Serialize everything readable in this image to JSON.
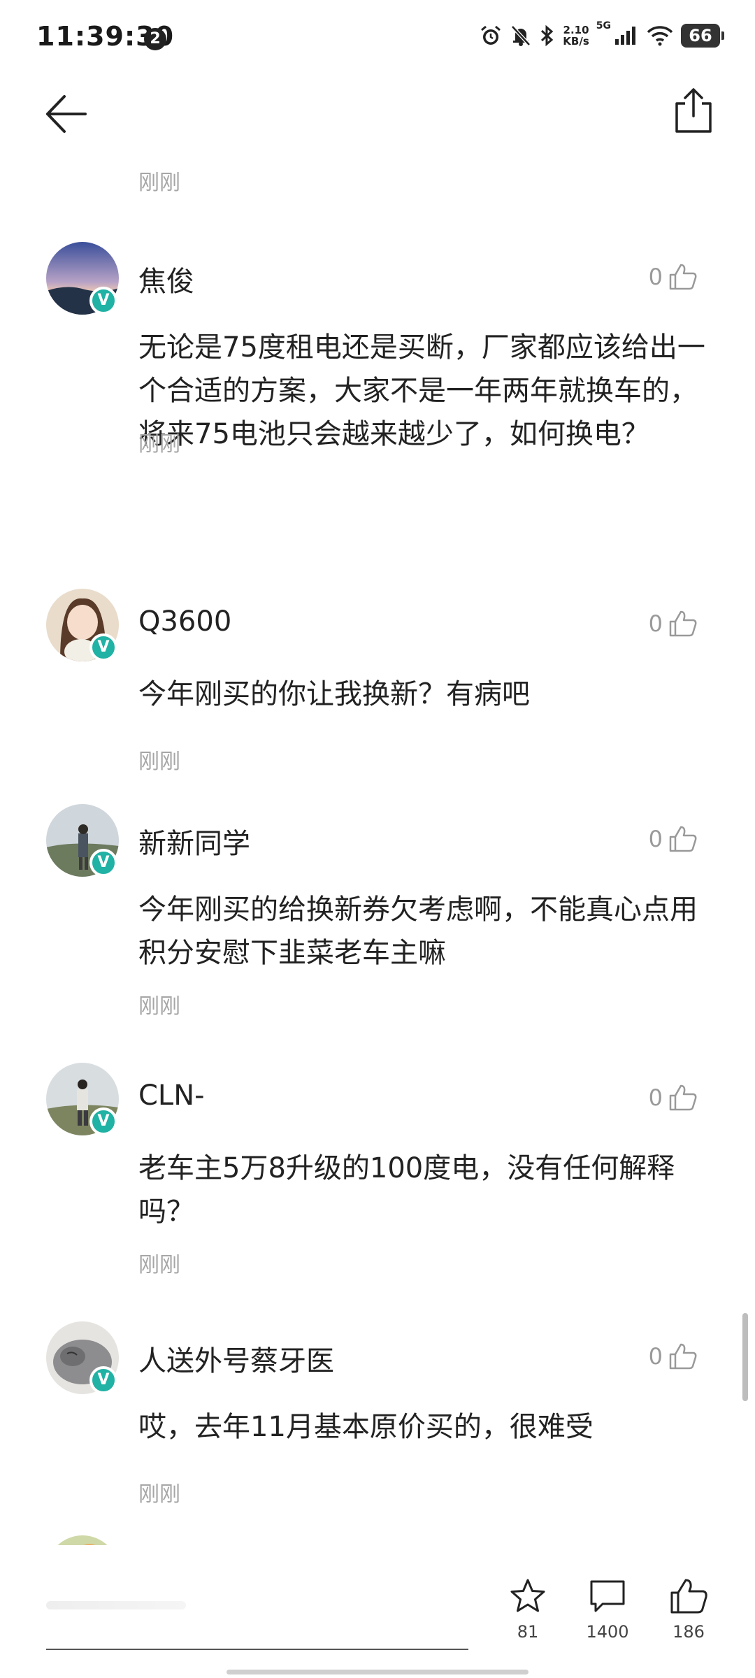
{
  "status_bar": {
    "time": "11:39:30",
    "notification_count": "2",
    "net_speed_value": "2.10",
    "net_speed_unit": "KB/s",
    "signal_label": "5G",
    "battery": "66"
  },
  "comments": {
    "top_time": "刚刚",
    "items": [
      {
        "username": "焦俊",
        "likes": "0",
        "text": "无论是75度租电还是买断，厂家都应该给出一个合适的方案，大家不是一年两年就换车的，将来75电池只会越来越少了，如何换电？",
        "time": "刚刚"
      },
      {
        "username": "Q3600",
        "likes": "0",
        "text": "今年刚买的你让我换新？有病吧",
        "time": "刚刚"
      },
      {
        "username": "新新同学",
        "likes": "0",
        "text": "今年刚买的给换新券欠考虑啊，不能真心点用积分安慰下韭菜老车主嘛",
        "time": "刚刚"
      },
      {
        "username": "CLN-",
        "likes": "0",
        "text": "老车主5万8升级的100度电，没有任何解释吗？",
        "time": "刚刚"
      },
      {
        "username": "人送外号蔡牙医",
        "likes": "0",
        "text": "哎，去年11月基本原价买的，很难受",
        "time": "刚刚"
      }
    ]
  },
  "bottom_bar": {
    "favorites_count": "81",
    "comments_count": "1400",
    "likes_count": "186"
  },
  "colors": {
    "verify_badge": "#20b2a4",
    "meta_text": "#a6a6a6"
  }
}
